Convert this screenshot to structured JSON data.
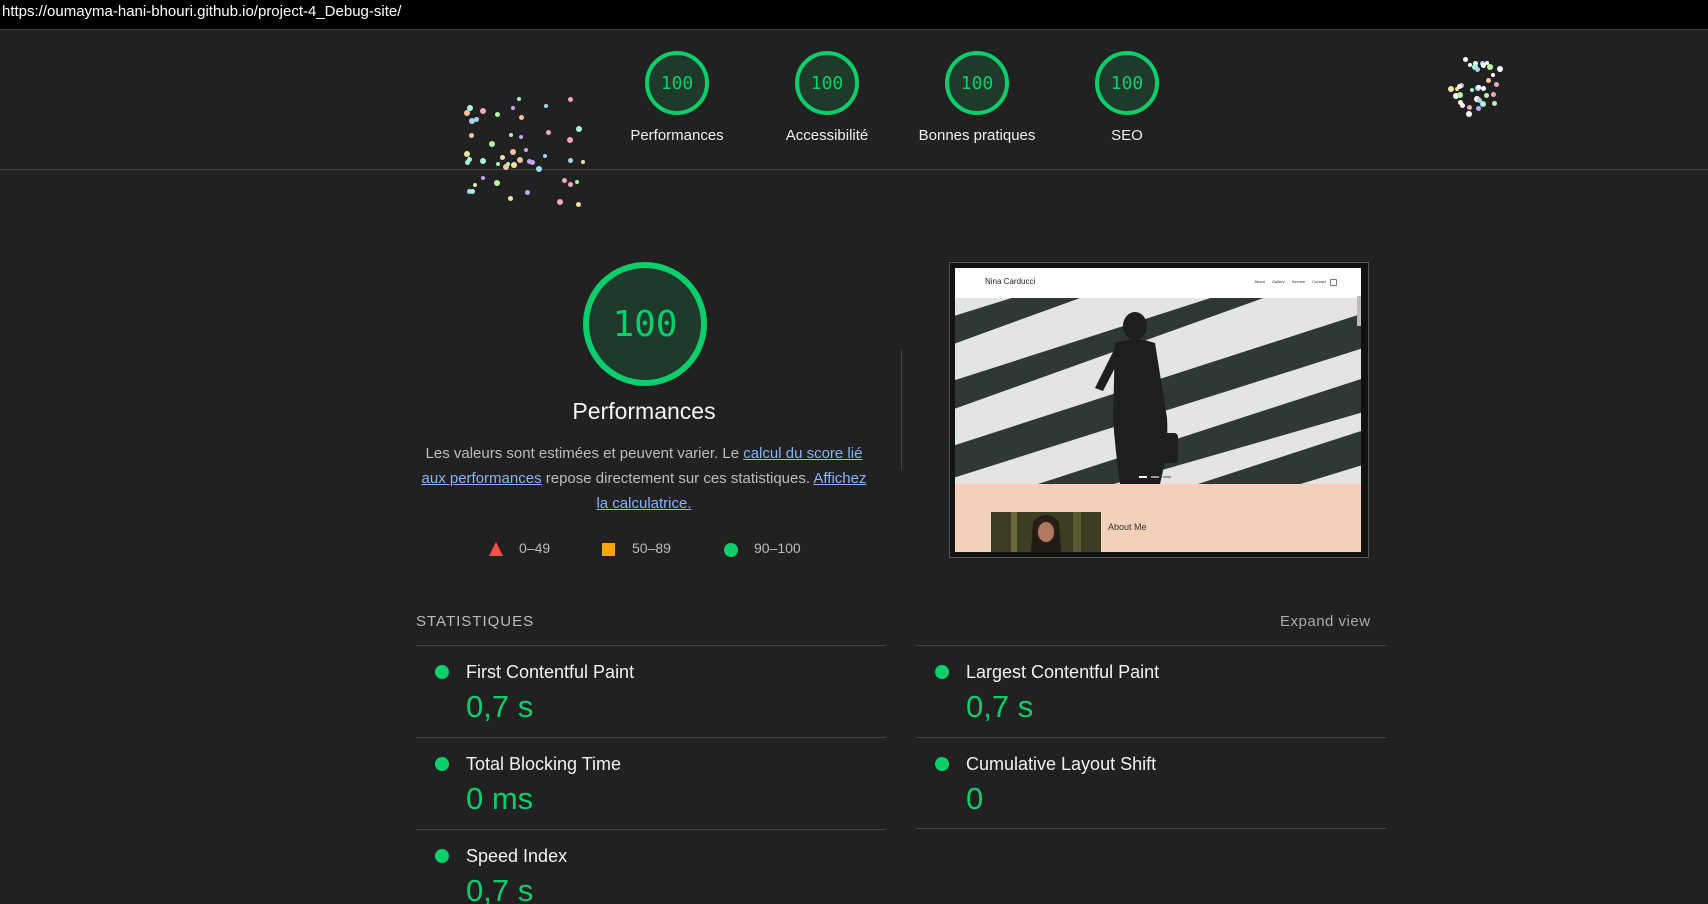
{
  "url": "https://oumayma-hani-bhouri.github.io/project-4_Debug-site/",
  "colors": {
    "pass": "#0cce6b",
    "average": "#ffa400",
    "fail": "#ff4e42",
    "background": "#212121"
  },
  "summary": [
    {
      "score": "100",
      "label": "Performances"
    },
    {
      "score": "100",
      "label": "Accessibilité"
    },
    {
      "score": "100",
      "label": "Bonnes pratiques"
    },
    {
      "score": "100",
      "label": "SEO"
    }
  ],
  "main": {
    "score": "100",
    "title": "Performances",
    "desc_1": "Les valeurs sont estimées et peuvent varier. Le ",
    "link_1": "calcul du score lié aux performances",
    "desc_2": " repose directement sur ces statistiques. ",
    "link_2": "Affichez la calculatrice."
  },
  "legend": [
    {
      "icon": "triangle-icon",
      "range": "0–49"
    },
    {
      "icon": "square-icon",
      "range": "50–89"
    },
    {
      "icon": "circle-icon",
      "range": "90–100"
    }
  ],
  "screenshot": {
    "brand": "Nina Carducci",
    "nav": [
      "About",
      "Gallery",
      "Service",
      "Contact"
    ],
    "about_title": "About Me"
  },
  "stats": {
    "heading": "STATISTIQUES",
    "expand_label": "Expand view",
    "metrics": [
      {
        "name": "First Contentful Paint",
        "value": "0,7 s"
      },
      {
        "name": "Largest Contentful Paint",
        "value": "0,7 s"
      },
      {
        "name": "Total Blocking Time",
        "value": "0 ms"
      },
      {
        "name": "Cumulative Layout Shift",
        "value": "0"
      },
      {
        "name": "Speed Index",
        "value": "0,7 s"
      }
    ]
  }
}
